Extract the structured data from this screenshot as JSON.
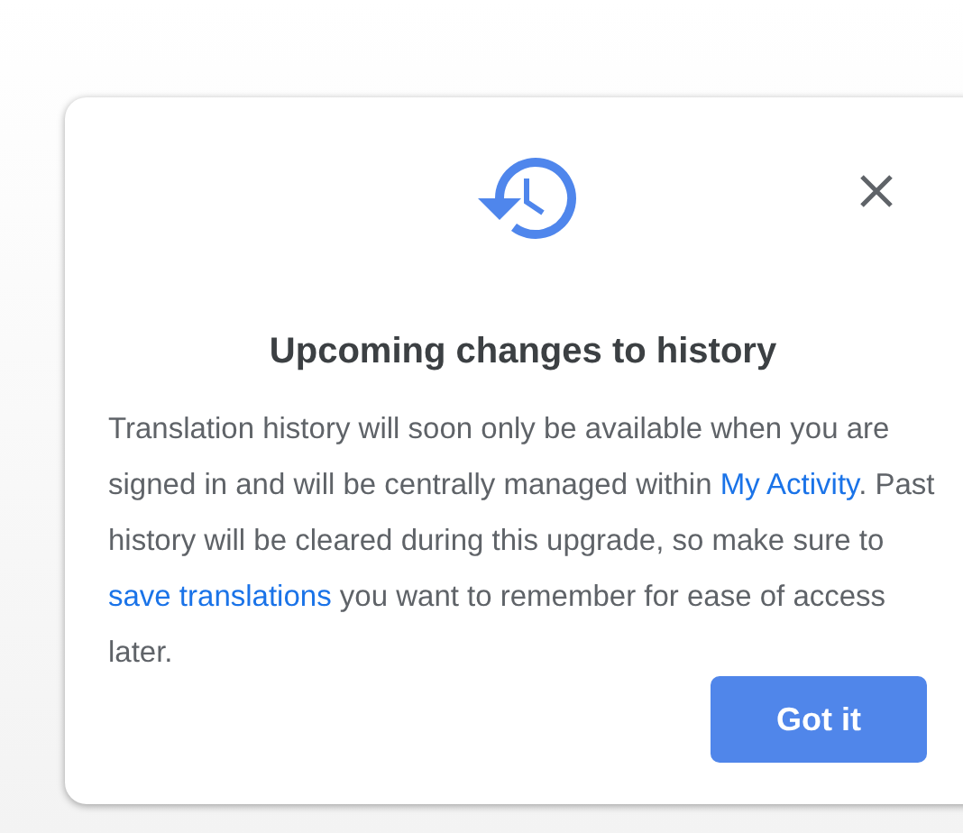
{
  "dialog": {
    "title": "Upcoming changes to history",
    "body": [
      {
        "kind": "text",
        "text": "Translation history will soon only be available when you are signed in and will be centrally managed within "
      },
      {
        "kind": "link",
        "text": "My Activity"
      },
      {
        "kind": "text",
        "text": ". Past history will be cleared during this upgrade, so make sure to "
      },
      {
        "kind": "link",
        "text": "save translations"
      },
      {
        "kind": "text",
        "text": " you want to remember for ease of access later."
      }
    ],
    "button": "Got it"
  }
}
